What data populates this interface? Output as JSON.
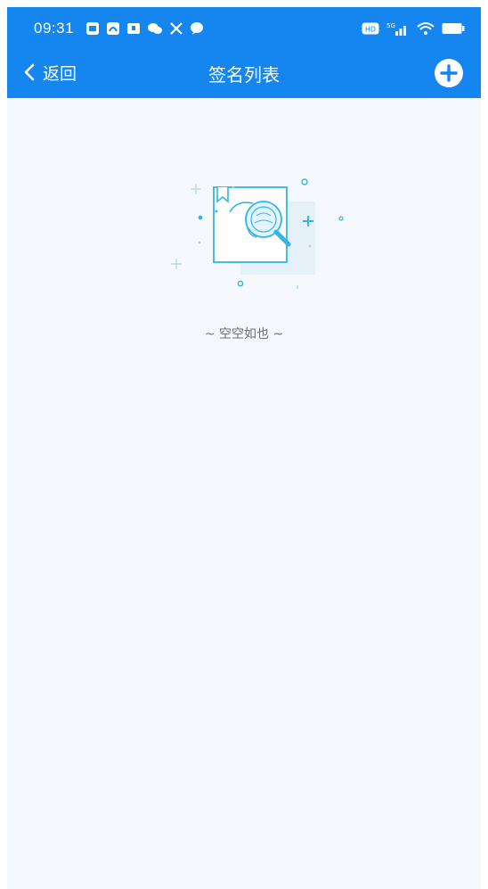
{
  "status_bar": {
    "time": "09:31",
    "notification_icons": [
      "message-square-icon",
      "app-icon",
      "chat-icon",
      "wechat-icon",
      "tools-icon",
      "speech-bubble-icon"
    ],
    "system_icons": [
      "hd-icon",
      "5g-signal-icon",
      "wifi-icon",
      "battery-icon"
    ]
  },
  "navbar": {
    "back_label": "返回",
    "title": "签名列表",
    "add_icon": "plus-circle-icon"
  },
  "empty_state": {
    "illustration": "document-magnifier-icon",
    "message": "~ 空空如也 ~"
  },
  "colors": {
    "header_bg": "#1585f0",
    "page_bg": "#f5f9fd",
    "illustration_accent": "#2fb6e8"
  }
}
